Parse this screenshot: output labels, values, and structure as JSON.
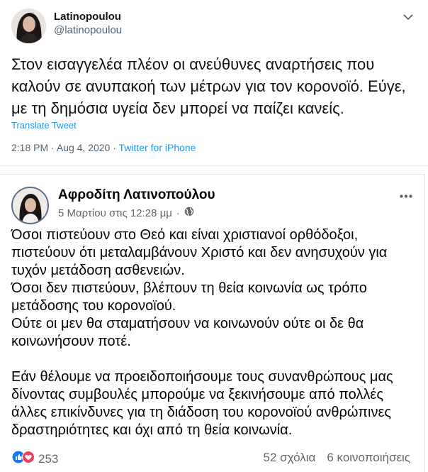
{
  "tweet": {
    "display_name": "Latinopoulou",
    "handle": "@latinopoulou",
    "text": "Στον εισαγγελέα πλέον οι ανεύθυνες αναρτήσεις που καλούν σε ανυπακοή των μέτρων για τον κορονοϊό. Εύγε, με τη δημόσια υγεία δεν μπορεί να παίζει κανείς.",
    "translate_label": "Translate Tweet",
    "time": "2:18 PM",
    "separator": "·",
    "date": "Aug 4, 2020",
    "source": "Twitter for iPhone"
  },
  "fb_post": {
    "author": "Αφροδίτη Λατινοπούλου",
    "date": "5 Μαρτίου στις 12:28 μμ",
    "dot": "·",
    "paragraphs": [
      "Όσοι πιστεύουν στο Θεό και είναι χριστιανοί ορθόδοξοι, πιστεύουν ότι μεταλαμβάνουν Χριστό και δεν ανησυχούν για τυχόν μετάδοση ασθενειών.\nΌσοι δεν πιστεύουν, βλέπουν τη θεία κοινωνία ως τρόπο μετάδοσης του κορονοϊού.\nΟύτε οι μεν θα σταματήσουν να κοινωνούν ούτε οι δε θα κοινωνήσουν ποτέ.",
      "Εάν θέλουμε να προειδοποιήσουμε τους συνανθρώπους μας δίνοντας συμβουλές μπορούμε να ξεκινήσουμε από πολλές άλλες επικίνδυνες για τη διάδοση του κορονοϊού ανθρώπινες δραστηριότητες και όχι από τη θεία κοινωνία."
    ],
    "reactions_count": "253",
    "comments": "52 σχόλια",
    "shares": "6 κοινοποιήσεις"
  },
  "colors": {
    "twitter_blue": "#1d9bf0",
    "fb_like": "#1877f2",
    "fb_love": "#f33e58",
    "muted": "#65676b"
  }
}
